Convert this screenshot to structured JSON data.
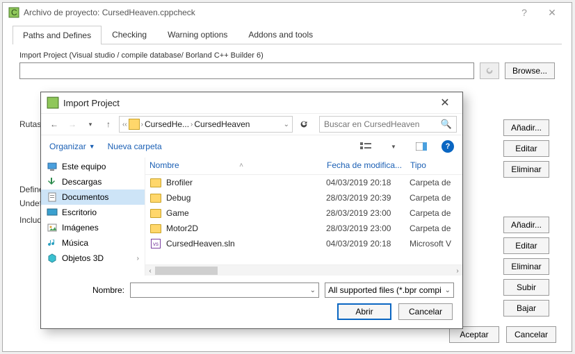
{
  "parent": {
    "title": "Archivo de proyecto: CursedHeaven.cppcheck",
    "tabs": [
      "Paths and Defines",
      "Checking",
      "Warning options",
      "Addons and tools"
    ],
    "active_tab": 0,
    "import_group_label": "Import Project (Visual studio / compile database/ Borland C++ Builder 6)",
    "browse_label": "Browse...",
    "rutas_label": "Rutas:",
    "defines_label": "Defines:",
    "undefs_label": "Undefs:",
    "includes_label": "Includes:",
    "rutas_btns": [
      "Añadir...",
      "Editar",
      "Eliminar"
    ],
    "includes_btns": [
      "Añadir...",
      "Editar",
      "Eliminar",
      "Subir",
      "Bajar"
    ],
    "ok_label": "Aceptar",
    "cancel_label": "Cancelar"
  },
  "dialog": {
    "title": "Import Project",
    "breadcrumb": [
      "CursedHe...",
      "CursedHeaven"
    ],
    "search_placeholder": "Buscar en CursedHeaven",
    "organize_label": "Organizar",
    "newfolder_label": "Nueva carpeta",
    "tree": [
      {
        "label": "Este equipo",
        "icon": "pc"
      },
      {
        "label": "Descargas",
        "icon": "download"
      },
      {
        "label": "Documentos",
        "icon": "doc",
        "selected": true
      },
      {
        "label": "Escritorio",
        "icon": "desktop"
      },
      {
        "label": "Imágenes",
        "icon": "images"
      },
      {
        "label": "Música",
        "icon": "music"
      },
      {
        "label": "Objetos 3D",
        "icon": "obj3d"
      }
    ],
    "columns": {
      "name": "Nombre",
      "date": "Fecha de modifica...",
      "type": "Tipo"
    },
    "rows": [
      {
        "icon": "folder",
        "name": "Brofiler",
        "date": "04/03/2019 20:18",
        "type": "Carpeta de"
      },
      {
        "icon": "folder",
        "name": "Debug",
        "date": "28/03/2019 20:39",
        "type": "Carpeta de"
      },
      {
        "icon": "folder",
        "name": "Game",
        "date": "28/03/2019 23:00",
        "type": "Carpeta de"
      },
      {
        "icon": "folder",
        "name": "Motor2D",
        "date": "28/03/2019 23:00",
        "type": "Carpeta de"
      },
      {
        "icon": "sln",
        "name": "CursedHeaven.sln",
        "date": "04/03/2019 20:18",
        "type": "Microsoft V"
      }
    ],
    "filename_label": "Nombre:",
    "filename_value": "",
    "filter_label": "All supported files (*.bpr compi",
    "open_label": "Abrir",
    "cancel_label": "Cancelar"
  }
}
